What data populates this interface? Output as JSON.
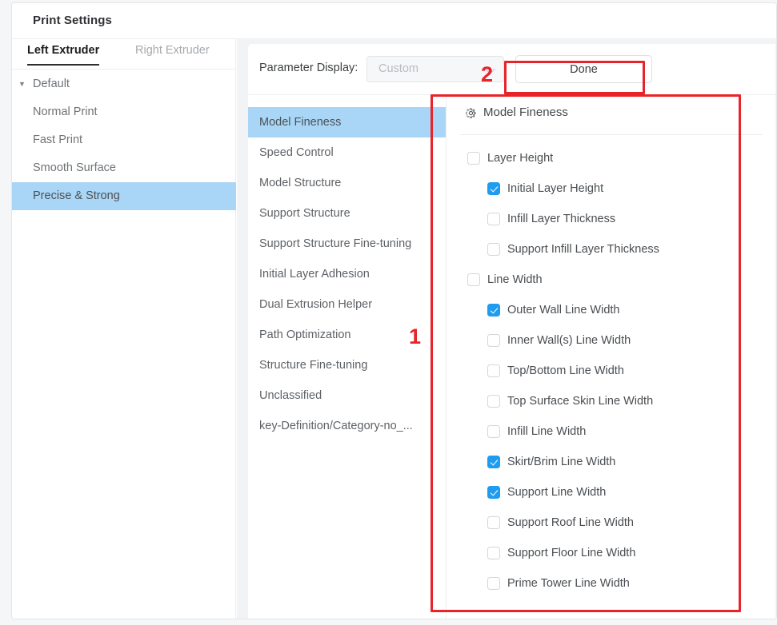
{
  "window": {
    "title": "Print Settings"
  },
  "sidebar": {
    "tabs": [
      {
        "label": "Left Extruder",
        "active": true
      },
      {
        "label": "Right Extruder",
        "active": false
      }
    ],
    "group": {
      "label": "Default",
      "caret": "caret-down-icon"
    },
    "presets": [
      {
        "label": "Normal Print",
        "selected": false
      },
      {
        "label": "Fast Print",
        "selected": false
      },
      {
        "label": "Smooth Surface",
        "selected": false
      },
      {
        "label": "Precise & Strong",
        "selected": true
      }
    ]
  },
  "toolbar": {
    "parameter_display_label": "Parameter Display:",
    "select_value": "Custom",
    "select_placeholder": "Custom",
    "done_label": "Done"
  },
  "categories": [
    {
      "label": "Model Fineness",
      "selected": true
    },
    {
      "label": "Speed Control",
      "selected": false
    },
    {
      "label": "Model Structure",
      "selected": false
    },
    {
      "label": "Support Structure",
      "selected": false
    },
    {
      "label": "Support Structure Fine-tuning",
      "selected": false
    },
    {
      "label": "Initial Layer Adhesion",
      "selected": false
    },
    {
      "label": "Dual Extrusion Helper",
      "selected": false
    },
    {
      "label": "Path Optimization",
      "selected": false
    },
    {
      "label": "Structure Fine-tuning",
      "selected": false
    },
    {
      "label": "Unclassified",
      "selected": false
    },
    {
      "label": "key-Definition/Category-no_...",
      "selected": false
    }
  ],
  "parameter_panel": {
    "header": "Model Fineness",
    "header_icon": "gear-icon",
    "rows": [
      {
        "label": "Layer Height",
        "checked": false,
        "level": 0
      },
      {
        "label": "Initial Layer Height",
        "checked": true,
        "level": 1
      },
      {
        "label": "Infill Layer Thickness",
        "checked": false,
        "level": 1
      },
      {
        "label": "Support Infill Layer Thickness",
        "checked": false,
        "level": 1
      },
      {
        "label": "Line Width",
        "checked": false,
        "level": 0
      },
      {
        "label": "Outer Wall Line Width",
        "checked": true,
        "level": 1
      },
      {
        "label": "Inner Wall(s) Line Width",
        "checked": false,
        "level": 1
      },
      {
        "label": "Top/Bottom Line Width",
        "checked": false,
        "level": 1
      },
      {
        "label": "Top Surface Skin Line Width",
        "checked": false,
        "level": 1
      },
      {
        "label": "Infill Line Width",
        "checked": false,
        "level": 1
      },
      {
        "label": "Skirt/Brim Line Width",
        "checked": true,
        "level": 1
      },
      {
        "label": "Support Line Width",
        "checked": true,
        "level": 1
      },
      {
        "label": "Support Roof Line Width",
        "checked": false,
        "level": 1
      },
      {
        "label": "Support Floor Line Width",
        "checked": false,
        "level": 1
      },
      {
        "label": "Prime Tower Line Width",
        "checked": false,
        "level": 1
      }
    ]
  },
  "annotations": [
    {
      "number": "1",
      "target": "parameter-panel"
    },
    {
      "number": "2",
      "target": "done-button"
    }
  ],
  "colors": {
    "accent_blue": "#1f9cf0",
    "selection_blue": "#a9d6f7",
    "annotation_red": "#e8232a"
  }
}
